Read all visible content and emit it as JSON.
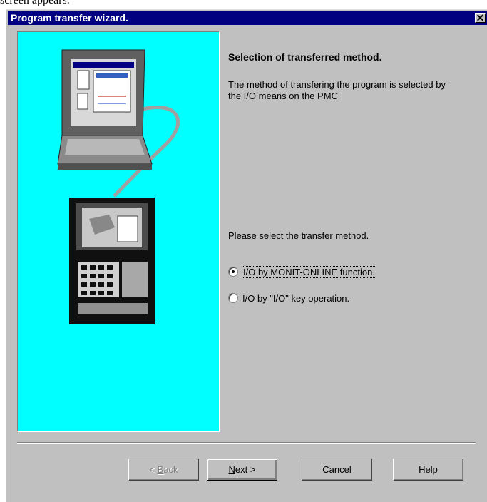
{
  "page_caption": "screen appears.",
  "window": {
    "title": "Program transfer wizard.",
    "close_glyph": "✕"
  },
  "content": {
    "heading": "Selection of transferred method.",
    "description": "The method of transfering the program is selected by the I/O means on the PMC",
    "prompt": "Please select the transfer method.",
    "options": [
      {
        "label": "I/O by MONIT-ONLINE function.",
        "selected": true
      },
      {
        "label": "I/O by \"I/O\" key operation.",
        "selected": false
      }
    ]
  },
  "buttons": {
    "back": {
      "prefix": "< ",
      "accel": "B",
      "rest": "ack",
      "enabled": false
    },
    "next": {
      "accel": "N",
      "rest": "ext >",
      "enabled": true
    },
    "cancel": "Cancel",
    "help": "Help"
  },
  "colors": {
    "panel": "#00ffff",
    "titlebar": "#000080",
    "dialog": "#c0c0c0"
  },
  "icons": [
    "laptop-icon",
    "cnc-controller-icon",
    "close-icon"
  ]
}
